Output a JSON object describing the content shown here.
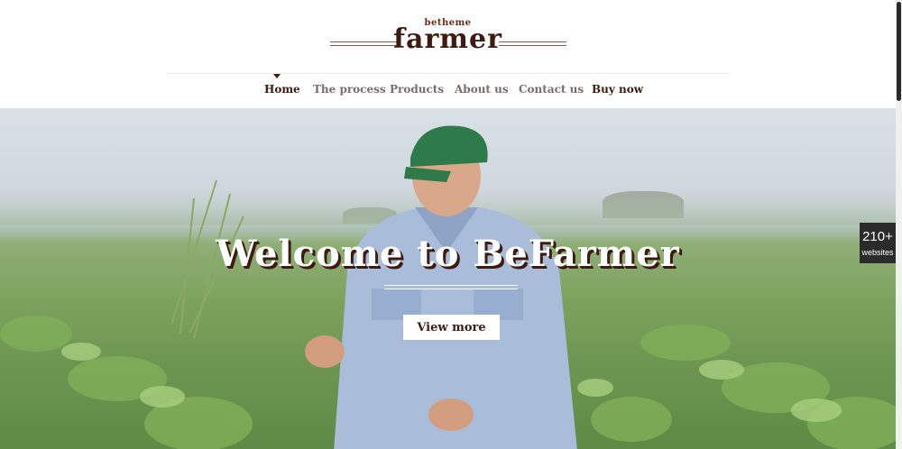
{
  "logo": {
    "small": "betheme",
    "main": "farmer"
  },
  "nav": {
    "items": [
      {
        "label": "Home",
        "active": true
      },
      {
        "label": "The process",
        "active": false
      },
      {
        "label": "Products",
        "active": false
      },
      {
        "label": "About us",
        "active": false
      },
      {
        "label": "Contact us",
        "active": false
      },
      {
        "label": "Buy now",
        "active": false
      }
    ]
  },
  "hero": {
    "title": "Welcome to BeFarmer",
    "button_label": "View more"
  },
  "side_badge": {
    "count": "210+",
    "label": "websites"
  },
  "colors": {
    "brand_dark": "#3f1a10",
    "nav_muted": "#7a6d68",
    "field_green": "#6d9652",
    "sky": "#d9e0e6",
    "badge_bg": "#2b2b2b"
  }
}
